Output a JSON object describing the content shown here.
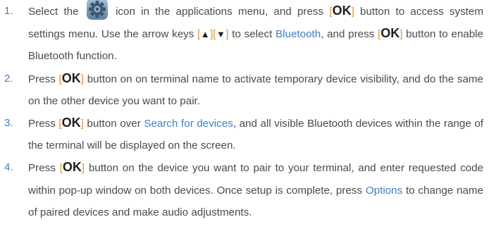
{
  "steps": [
    {
      "number": "1.",
      "t1": "Select the ",
      "icon": "settings-gear-icon",
      "t2": " icon in the applications menu, and press ",
      "ok": "OK",
      "t3": " button to access system settings menu. Use the arrow keys ",
      "up": "▲",
      "down": "▼",
      "t4": " to select ",
      "link": "Bluetooth",
      "t5": ", and press ",
      "t6": " button to enable Bluetooth function."
    },
    {
      "number": "2.",
      "t1": "Press ",
      "ok": "OK",
      "t2": " button on on terminal name to activate temporary device visibility, and do the same on the other device you want to pair."
    },
    {
      "number": "3.",
      "t1": "Press ",
      "ok": "OK",
      "t2": " button over ",
      "link": "Search for devices",
      "t3": ", and all visible Bluetooth devices within the range of the terminal will be displayed on the screen."
    },
    {
      "number": "4.",
      "t1": "Press ",
      "ok": "OK",
      "t2": " button on the device you want to pair to your terminal, and enter requested code within pop-up window on both devices. Once setup is complete, press ",
      "link": "Options",
      "t3": " to change name of paired devices and make audio adjustments."
    }
  ],
  "brackets": {
    "open": "[",
    "close": "]"
  },
  "colors": {
    "text": "#4a4a4a",
    "accent_blue": "#3f7fc4",
    "bracket_orange": "#e8952e",
    "key": "#1e1e1e"
  }
}
